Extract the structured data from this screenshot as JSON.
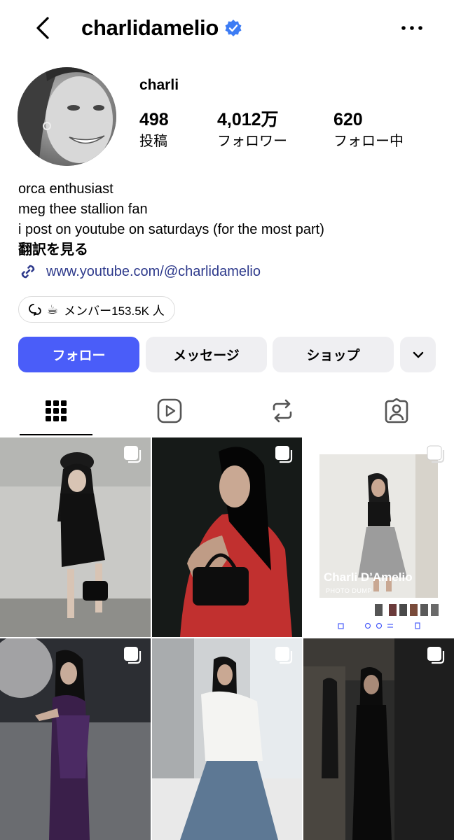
{
  "header": {
    "username": "charlidamelio",
    "back_icon": "chevron-left-icon",
    "verified_icon": "verified-badge-icon",
    "more_icon": "more-horizontal-icon"
  },
  "profile": {
    "display_name": "charli",
    "stats": [
      {
        "value": "498",
        "label": "投稿"
      },
      {
        "value": "4,012万",
        "label": "フォロワー"
      },
      {
        "value": "620",
        "label": "フォロー中"
      }
    ]
  },
  "bio": {
    "lines": [
      "orca enthusiast",
      "meg thee stallion fan",
      "i post on youtube on saturdays (for the most part)"
    ],
    "translate_label": "翻訳を見る",
    "link_url": "www.youtube.com/@charlidamelio",
    "link_icon": "link-icon"
  },
  "channel_chip": {
    "emoji": "☕",
    "text": "メンバー153.5K 人",
    "icon": "broadcast-channel-icon"
  },
  "actions": {
    "follow_label": "フォロー",
    "message_label": "メッセージ",
    "shop_label": "ショップ",
    "more_icon": "chevron-down-icon"
  },
  "tabs": [
    {
      "name": "posts",
      "icon": "grid-icon",
      "active": true
    },
    {
      "name": "reels",
      "icon": "reels-icon",
      "active": false
    },
    {
      "name": "reposts",
      "icon": "repost-icon",
      "active": false
    },
    {
      "name": "tagged",
      "icon": "tagged-icon",
      "active": false
    }
  ],
  "posts": [
    {
      "overlay_title": "",
      "overlay_subtitle": ""
    },
    {
      "overlay_title": "",
      "overlay_subtitle": ""
    },
    {
      "overlay_title": "Charli D’Amelio",
      "overlay_subtitle": "PHOTO DUMP"
    },
    {
      "overlay_title": "",
      "overlay_subtitle": ""
    },
    {
      "overlay_title": "",
      "overlay_subtitle": ""
    },
    {
      "overlay_title": "",
      "overlay_subtitle": ""
    }
  ],
  "colors": {
    "accent": "#4a5df9",
    "link": "#2e3a8c",
    "secondary_button": "#efeff2",
    "verified": "#3d7cf4"
  }
}
